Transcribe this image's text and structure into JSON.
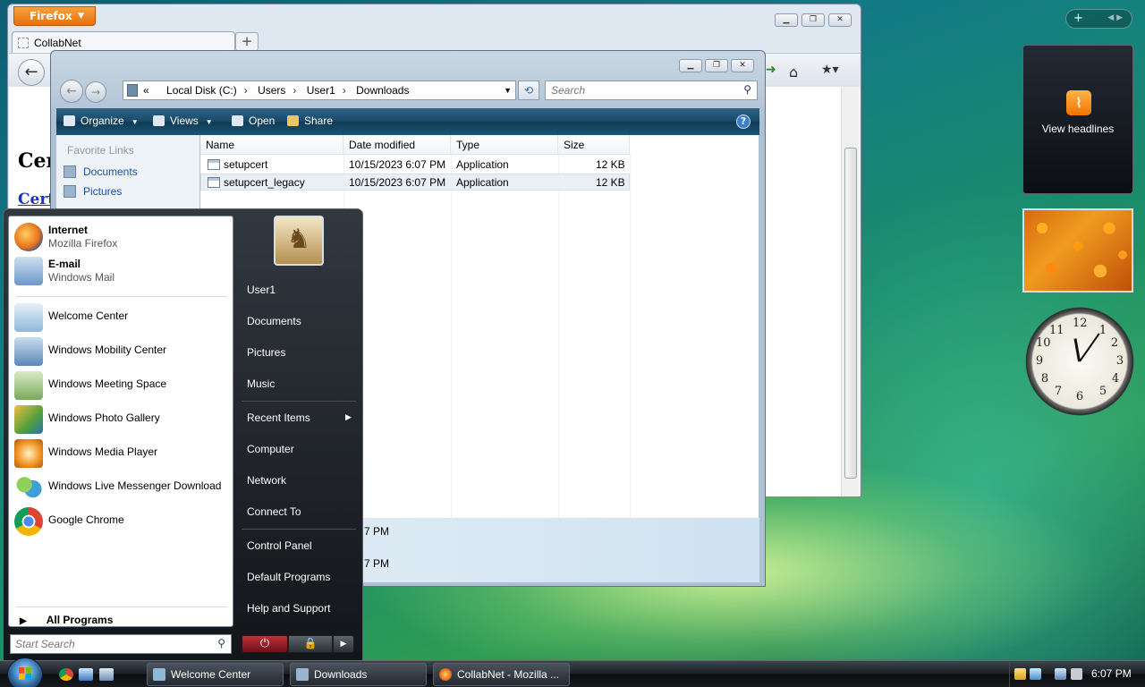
{
  "firefox": {
    "menu_label": "Firefox",
    "tab_title": "CollabNet",
    "new_tab": "+",
    "page_heading": "Cer",
    "page_link": "Cert"
  },
  "explorer": {
    "breadcrumb": [
      "Local Disk (C:)",
      "Users",
      "User1",
      "Downloads"
    ],
    "breadcrumb_prefix": "«",
    "search_placeholder": "Search",
    "toolbar": {
      "organize": "Organize",
      "views": "Views",
      "open": "Open",
      "share": "Share"
    },
    "favorite_links_header": "Favorite Links",
    "favorites": [
      "Documents",
      "Pictures"
    ],
    "columns": [
      "Name",
      "Date modified",
      "Type",
      "Size"
    ],
    "files": [
      {
        "name": "setupcert",
        "date": "10/15/2023 6:07 PM",
        "type": "Application",
        "size": "12 KB"
      },
      {
        "name": "setupcert_legacy",
        "date": "10/15/2023 6:07 PM",
        "type": "Application",
        "size": "12 KB"
      }
    ],
    "details_times": [
      "7 PM",
      "7 PM"
    ]
  },
  "gadgets": {
    "rss_label": "View headlines",
    "sidebar_add": "+"
  },
  "start_menu": {
    "pinned": [
      {
        "title": "Internet",
        "subtitle": "Mozilla Firefox",
        "icon": "firefox-icon",
        "color": "#e8701a"
      },
      {
        "title": "E-mail",
        "subtitle": "Windows Mail",
        "icon": "mail-icon",
        "color": "#6a98c9"
      }
    ],
    "recent": [
      {
        "label": "Welcome Center",
        "icon": "welcome-center-icon",
        "color": "#8fb8d8"
      },
      {
        "label": "Windows Mobility Center",
        "icon": "mobility-center-icon",
        "color": "#5b87b8"
      },
      {
        "label": "Windows Meeting Space",
        "icon": "meeting-space-icon",
        "color": "#7aa85a"
      },
      {
        "label": "Windows Photo Gallery",
        "icon": "photo-gallery-icon",
        "color": "#4f9e3c"
      },
      {
        "label": "Windows Media Player",
        "icon": "media-player-icon",
        "color": "#f09020"
      },
      {
        "label": "Windows Live Messenger Download",
        "icon": "messenger-icon",
        "color": "#3fa0d8"
      },
      {
        "label": "Google Chrome",
        "icon": "chrome-icon",
        "color": "#d94535"
      }
    ],
    "all_programs": "All Programs",
    "search_placeholder": "Start Search",
    "right_links": [
      "User1",
      "Documents",
      "Pictures",
      "Music",
      "Recent Items",
      "Computer",
      "Network",
      "Connect To",
      "Control Panel",
      "Default Programs",
      "Help and Support"
    ]
  },
  "taskbar": {
    "tasks": [
      {
        "label": "Welcome Center",
        "color": "#8fb8d8"
      },
      {
        "label": "Downloads",
        "color": "#9bb3cc"
      },
      {
        "label": "CollabNet - Mozilla ...",
        "color": "#e8701a"
      }
    ],
    "clock": "6:07 PM"
  }
}
